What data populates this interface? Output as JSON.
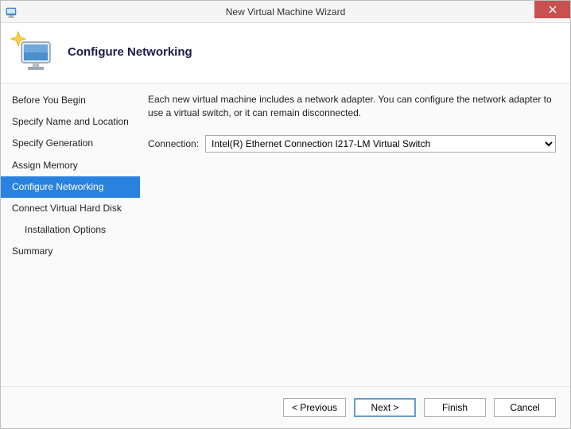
{
  "window": {
    "title": "New Virtual Machine Wizard"
  },
  "header": {
    "title": "Configure Networking"
  },
  "sidebar": {
    "items": [
      {
        "label": "Before You Begin",
        "active": false,
        "indent": false
      },
      {
        "label": "Specify Name and Location",
        "active": false,
        "indent": false
      },
      {
        "label": "Specify Generation",
        "active": false,
        "indent": false
      },
      {
        "label": "Assign Memory",
        "active": false,
        "indent": false
      },
      {
        "label": "Configure Networking",
        "active": true,
        "indent": false
      },
      {
        "label": "Connect Virtual Hard Disk",
        "active": false,
        "indent": false
      },
      {
        "label": "Installation Options",
        "active": false,
        "indent": true
      },
      {
        "label": "Summary",
        "active": false,
        "indent": false
      }
    ]
  },
  "content": {
    "description": "Each new virtual machine includes a network adapter. You can configure the network adapter to use a virtual switch, or it can remain disconnected.",
    "connection_label": "Connection:",
    "connection_value": "Intel(R) Ethernet Connection I217-LM Virtual Switch"
  },
  "footer": {
    "previous": "< Previous",
    "next": "Next >",
    "finish": "Finish",
    "cancel": "Cancel"
  }
}
